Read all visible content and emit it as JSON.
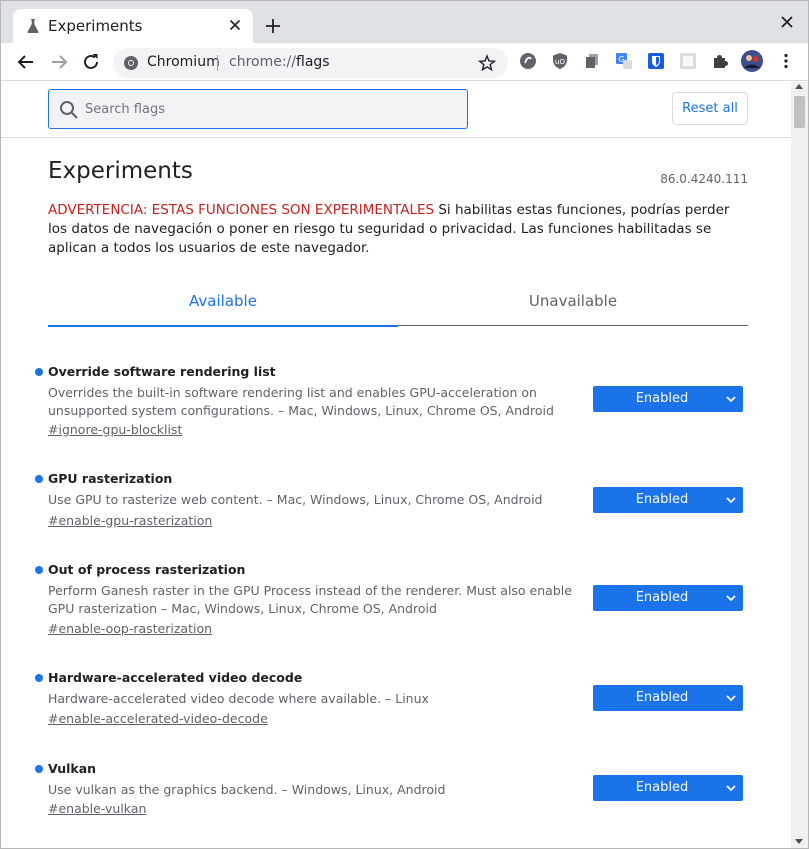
{
  "browser": {
    "tab": {
      "title": "Experiments",
      "favicon": "flask-icon"
    },
    "omnibox": {
      "site_label": "Chromium",
      "url_scheme": "chrome://",
      "url_path": "flags"
    },
    "icons": [
      "back-arrow-icon",
      "forward-arrow-icon",
      "reload-icon",
      "star-icon",
      "extension-icons",
      "puzzle-icon",
      "avatar",
      "kebab-menu-icon"
    ]
  },
  "search": {
    "placeholder": "Search flags",
    "value": ""
  },
  "reset_label": "Reset all",
  "page": {
    "title": "Experiments",
    "version": "86.0.4240.111",
    "warning_strong": "ADVERTENCIA: ESTAS FUNCIONES SON EXPERIMENTALES",
    "warning_text": " Si habilitas estas funciones, podrías perder los datos de navegación o poner en riesgo tu seguridad o privacidad. Las funciones habilitadas se aplican a todos los usuarios de este navegador."
  },
  "tabs": {
    "available": "Available",
    "unavailable": "Unavailable",
    "selected": "available"
  },
  "flags": [
    {
      "name": "Override software rendering list",
      "description": "Overrides the built-in software rendering list and enables GPU-acceleration on unsupported system configurations. – Mac, Windows, Linux, Chrome OS, Android",
      "link": "#ignore-gpu-blocklist",
      "state": "Enabled"
    },
    {
      "name": "GPU rasterization",
      "description": "Use GPU to rasterize web content. – Mac, Windows, Linux, Chrome OS, Android",
      "link": "#enable-gpu-rasterization",
      "state": "Enabled"
    },
    {
      "name": "Out of process rasterization",
      "description": "Perform Ganesh raster in the GPU Process instead of the renderer. Must also enable GPU rasterization – Mac, Windows, Linux, Chrome OS, Android",
      "link": "#enable-oop-rasterization",
      "state": "Enabled"
    },
    {
      "name": "Hardware-accelerated video decode",
      "description": "Hardware-accelerated video decode where available. – Linux",
      "link": "#enable-accelerated-video-decode",
      "state": "Enabled"
    },
    {
      "name": "Vulkan",
      "description": "Use vulkan as the graphics backend. – Windows, Linux, Android",
      "link": "#enable-vulkan",
      "state": "Enabled"
    }
  ],
  "colors": {
    "accent": "#1a73e8",
    "warning": "#c5221f",
    "tabstrip": "#dee1e6"
  }
}
